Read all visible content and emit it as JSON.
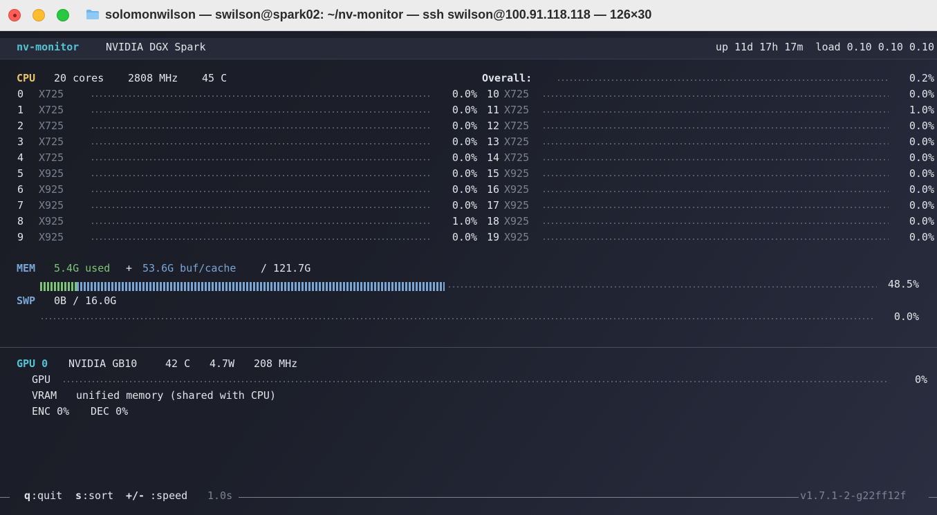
{
  "window": {
    "title": "solomonwilson — swilson@spark02: ~/nv-monitor — ssh swilson@100.91.118.118 — 126×30"
  },
  "header": {
    "app_name": "nv-monitor",
    "machine": "NVIDIA DGX Spark",
    "uptime_load": "up 11d 17h 17m  load 0.10 0.10 0.10"
  },
  "cpu": {
    "label": "CPU",
    "cores": "20 cores",
    "freq": "2808 MHz",
    "temp": "45 C",
    "overall_label": "Overall:",
    "overall_value": "0.2%",
    "left": [
      {
        "id": "0",
        "type": "X725",
        "value": "0.0%"
      },
      {
        "id": "1",
        "type": "X725",
        "value": "0.0%"
      },
      {
        "id": "2",
        "type": "X725",
        "value": "0.0%"
      },
      {
        "id": "3",
        "type": "X725",
        "value": "0.0%"
      },
      {
        "id": "4",
        "type": "X725",
        "value": "0.0%"
      },
      {
        "id": "5",
        "type": "X925",
        "value": "0.0%"
      },
      {
        "id": "6",
        "type": "X925",
        "value": "0.0%"
      },
      {
        "id": "7",
        "type": "X925",
        "value": "0.0%"
      },
      {
        "id": "8",
        "type": "X925",
        "value": "1.0%"
      },
      {
        "id": "9",
        "type": "X925",
        "value": "0.0%"
      }
    ],
    "right": [
      {
        "id": "10",
        "type": "X725",
        "value": "0.0%"
      },
      {
        "id": "11",
        "type": "X725",
        "value": "1.0%"
      },
      {
        "id": "12",
        "type": "X725",
        "value": "0.0%"
      },
      {
        "id": "13",
        "type": "X725",
        "value": "0.0%"
      },
      {
        "id": "14",
        "type": "X725",
        "value": "0.0%"
      },
      {
        "id": "15",
        "type": "X925",
        "value": "0.0%"
      },
      {
        "id": "16",
        "type": "X925",
        "value": "0.0%"
      },
      {
        "id": "17",
        "type": "X925",
        "value": "0.0%"
      },
      {
        "id": "18",
        "type": "X925",
        "value": "0.0%"
      },
      {
        "id": "19",
        "type": "X925",
        "value": "0.0%"
      }
    ]
  },
  "mem": {
    "label": "MEM",
    "used": "5.4G used",
    "plus": "+",
    "cache": "53.6G buf/cache",
    "total": "/ 121.7G",
    "percent": "48.5%",
    "used_fraction": 0.044,
    "cache_fraction": 0.44,
    "used_color": "#7cc576",
    "cache_color": "#7aa6d6"
  },
  "swap": {
    "label": "SWP",
    "text": "0B / 16.0G",
    "percent": "0.0%"
  },
  "gpu": {
    "label": "GPU 0",
    "name": "NVIDIA GB10",
    "temp": "42 C",
    "power": "4.7W",
    "clock": "208 MHz",
    "util_label": "GPU",
    "util_value": "0%",
    "vram_label": "VRAM",
    "vram_text": "unified memory (shared with CPU)",
    "enc": "ENC 0%",
    "dec": "DEC 0%"
  },
  "footer": {
    "quit_key": "q",
    "quit_label": ":quit",
    "sort_key": "s",
    "sort_label": ":sort",
    "speed_key": "+/-",
    "speed_label": ":speed",
    "speed_value": "1.0s",
    "version": "v1.7.1-2-g22ff12f"
  },
  "colors": {
    "accent_teal": "#53c4d4",
    "cpu_yellow": "#e9c46a",
    "mem_green": "#7cc576",
    "mem_blue": "#7aa6d6"
  }
}
